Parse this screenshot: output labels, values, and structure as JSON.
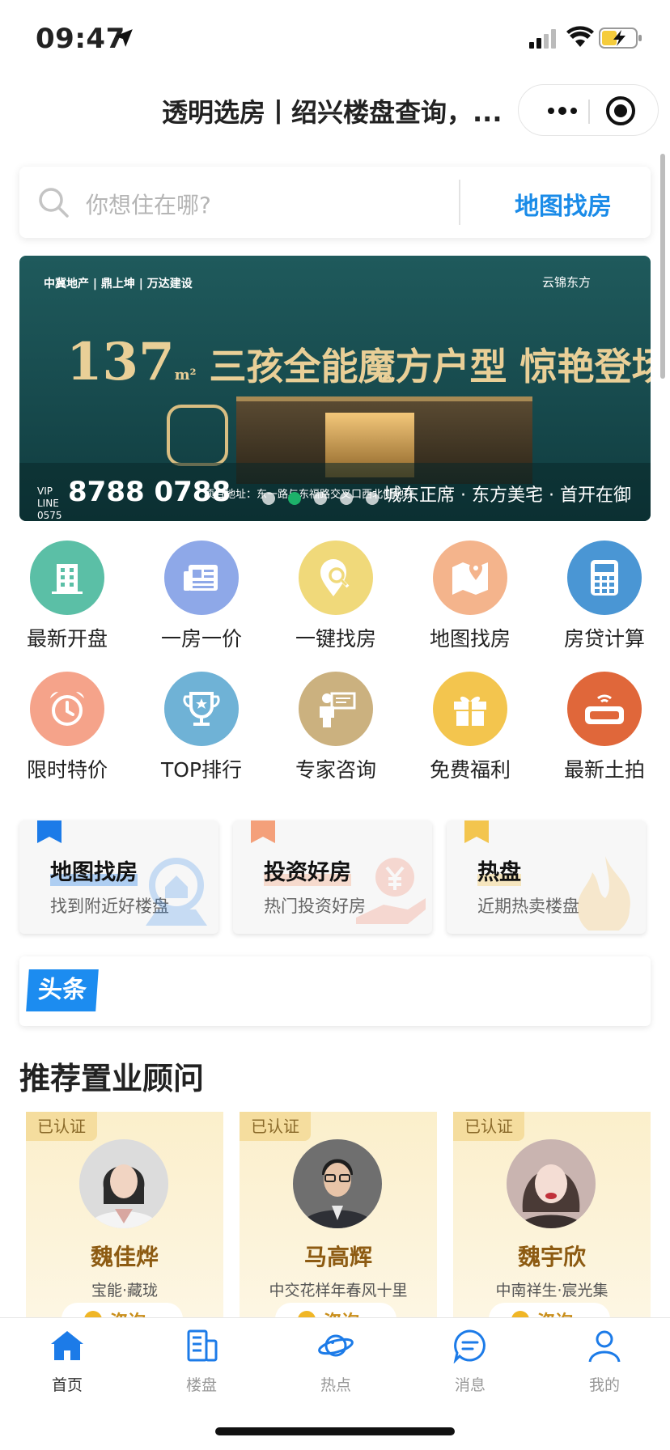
{
  "status_bar": {
    "time": "09:47"
  },
  "nav": {
    "title": "透明选房丨绍兴楼盘查询，..."
  },
  "search": {
    "placeholder": "你想住在哪?",
    "map_button": "地图找房"
  },
  "banner": {
    "brand_left": "中冀地产 | 鼎上坤 | 万达建设",
    "brand_right": "云锦东方",
    "area_number": "137",
    "area_unit": "m²",
    "headline": "三孩全能魔方户型 惊艳登场",
    "vip_line": "VIP LINE 0575",
    "phone": "8788 0788",
    "address": "项目地址：东一路与东福路交叉口西北侧地块",
    "slogan": "城东正席 · 东方美宅 · 首开在御",
    "page_count": 5,
    "active_index": 1
  },
  "quick_icons": [
    {
      "label": "最新开盘",
      "icon": "building-icon",
      "color": "#5bbfa6"
    },
    {
      "label": "一房一价",
      "icon": "newspaper-icon",
      "color": "#8ea8e8"
    },
    {
      "label": "一键找房",
      "icon": "location-search-icon",
      "color": "#f0d97a"
    },
    {
      "label": "地图找房",
      "icon": "map-pin-icon",
      "color": "#f4b48c"
    },
    {
      "label": "房贷计算",
      "icon": "calculator-icon",
      "color": "#4a96d4"
    },
    {
      "label": "限时特价",
      "icon": "alarm-clock-icon",
      "color": "#f5a38a"
    },
    {
      "label": "TOP排行",
      "icon": "trophy-icon",
      "color": "#6fb2d6"
    },
    {
      "label": "专家咨询",
      "icon": "presenter-icon",
      "color": "#cbb17f"
    },
    {
      "label": "免费福利",
      "icon": "gift-icon",
      "color": "#f3c54e"
    },
    {
      "label": "最新土拍",
      "icon": "vr-headset-icon",
      "color": "#e0673a"
    }
  ],
  "feature_cards": [
    {
      "title": "地图找房",
      "subtitle": "找到附近好楼盘",
      "accent": "#1c7be8"
    },
    {
      "title": "投资好房",
      "subtitle": "热门投资好房",
      "accent": "#f4a07a"
    },
    {
      "title": "热盘",
      "subtitle": "近期热卖楼盘",
      "accent": "#f3c54e"
    }
  ],
  "news": {
    "tag": "头条"
  },
  "advisors": {
    "section_title": "推荐置业顾问",
    "verified_label": "已认证",
    "consult_label": "咨询",
    "items": [
      {
        "name": "魏佳烨",
        "project": "宝能·藏珑"
      },
      {
        "name": "马高辉",
        "project": "中交花样年春风十里"
      },
      {
        "name": "魏宇欣",
        "project": "中南祥生·宸光集"
      }
    ]
  },
  "tabbar": [
    {
      "label": "首页",
      "icon": "home-icon",
      "active": true
    },
    {
      "label": "楼盘",
      "icon": "building-list-icon",
      "active": false
    },
    {
      "label": "热点",
      "icon": "planet-icon",
      "active": false
    },
    {
      "label": "消息",
      "icon": "message-icon",
      "active": false
    },
    {
      "label": "我的",
      "icon": "profile-icon",
      "active": false
    }
  ]
}
